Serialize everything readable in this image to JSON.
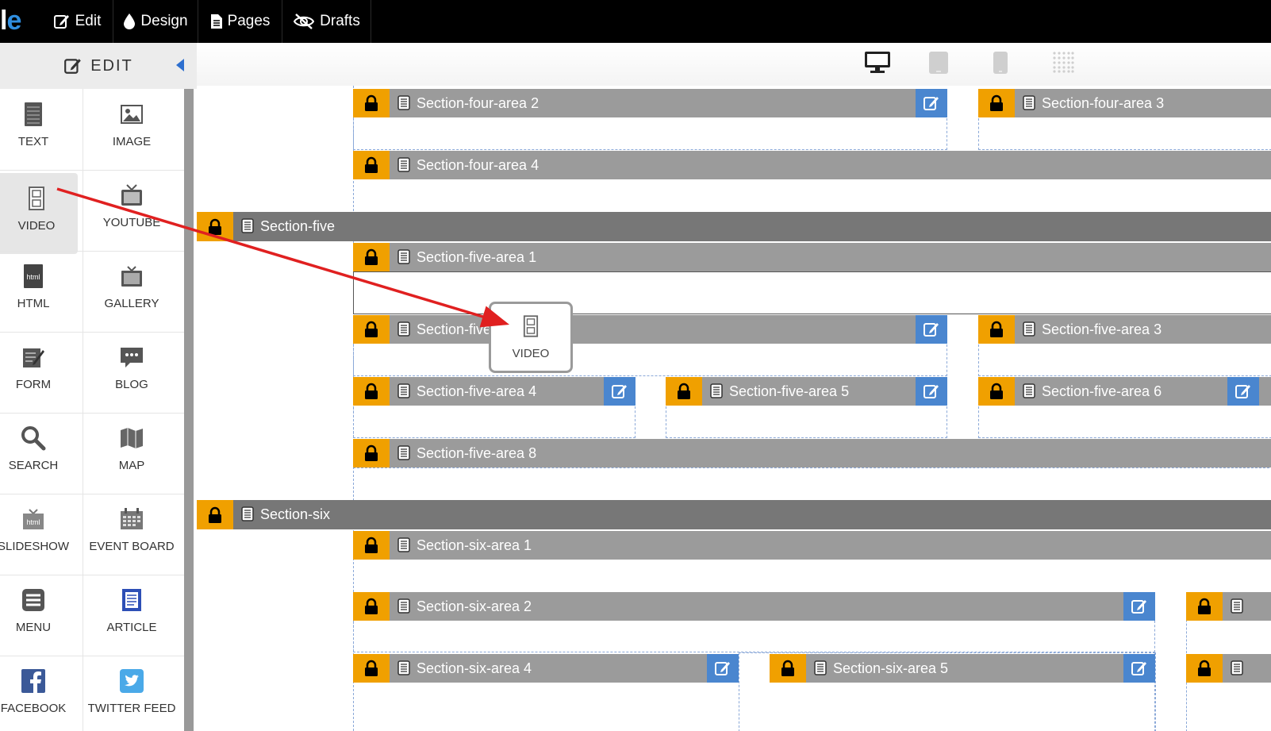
{
  "brand": {
    "logo_part1": "l",
    "logo_part2": "e"
  },
  "nav": {
    "tabs": [
      {
        "label": "Edit",
        "icon": "edit-icon"
      },
      {
        "label": "Design",
        "icon": "droplet-icon"
      },
      {
        "label": "Pages",
        "icon": "page-icon"
      },
      {
        "label": "Drafts",
        "icon": "eye-slash-icon"
      }
    ]
  },
  "edit_panel": {
    "title": "EDIT"
  },
  "devices": [
    "desktop-icon",
    "tablet-landscape-icon",
    "phone-icon",
    "grid-icon"
  ],
  "widgets": [
    {
      "label": "TEXT",
      "icon": "text-icon"
    },
    {
      "label": "IMAGE",
      "icon": "image-icon"
    },
    {
      "label": "VIDEO",
      "icon": "film-icon",
      "selected": true
    },
    {
      "label": "YOUTUBE",
      "icon": "tv-icon"
    },
    {
      "label": "HTML",
      "icon": "html-icon"
    },
    {
      "label": "GALLERY",
      "icon": "gallery-icon"
    },
    {
      "label": "FORM",
      "icon": "form-icon"
    },
    {
      "label": "BLOG",
      "icon": "chat-icon"
    },
    {
      "label": "SEARCH",
      "icon": "search-icon"
    },
    {
      "label": "MAP",
      "icon": "map-icon"
    },
    {
      "label": "SLIDESHOW",
      "icon": "slideshow-icon"
    },
    {
      "label": "EVENT BOARD",
      "icon": "calendar-icon"
    },
    {
      "label": "MENU",
      "icon": "menu-icon"
    },
    {
      "label": "ARTICLE",
      "icon": "article-icon"
    },
    {
      "label": "FACEBOOK",
      "icon": "facebook-icon"
    },
    {
      "label": "TWITTER FEED",
      "icon": "twitter-icon"
    }
  ],
  "canvas": {
    "section_four_area_2": "Section-four-area 2",
    "section_four_area_3": "Section-four-area 3",
    "section_four_area_4": "Section-four-area 4",
    "section_five": "Section-five",
    "section_five_area_1": "Section-five-area 1",
    "section_five_area_2": "Section-five",
    "section_five_area_3": "Section-five-area 3",
    "section_five_area_4": "Section-five-area 4",
    "section_five_area_5": "Section-five-area 5",
    "section_five_area_6": "Section-five-area 6",
    "section_five_area_8": "Section-five-area 8",
    "section_six": "Section-six",
    "section_six_area_1": "Section-six-area 1",
    "section_six_area_2": "Section-six-area 2",
    "section_six_area_4": "Section-six-area 4",
    "section_six_area_5": "Section-six-area 5"
  },
  "drag_ghost": {
    "label": "VIDEO",
    "icon": "film-icon"
  },
  "colors": {
    "lock": "#f0a000",
    "edit_button": "#4a86cf",
    "area_bar": "#9b9b9b",
    "section_bar": "#777777",
    "arrow": "#e02020"
  }
}
